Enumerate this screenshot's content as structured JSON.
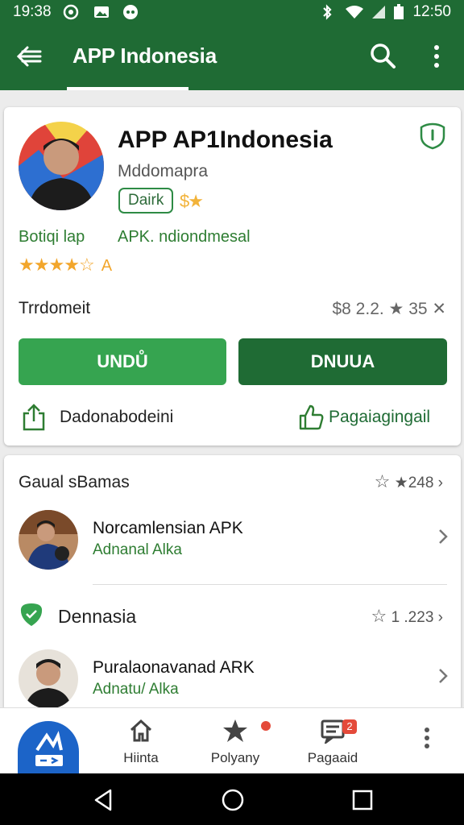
{
  "status_bar": {
    "time_left": "19:38",
    "time_right": "12:50"
  },
  "app_bar": {
    "title": "APP Indonesia"
  },
  "app_card": {
    "name": "APP AP1Indonesia",
    "developer": "Mddomapra",
    "badge": "Dairk",
    "category": "Botiqi lap",
    "apk_label": "APK. ndiondmesal",
    "rating_suffix": "A",
    "downloads_label": "Trrdomeit",
    "downloads_value": "$8 2.2. ★ 35 ✕",
    "primary_button": "UNDŮ",
    "secondary_button": "DNUUA",
    "share_label": "Dadonabodeini",
    "page_label": "Pagaiagingail",
    "rating_stars": 3.5
  },
  "sections": [
    {
      "title": "Gaual sBamas",
      "count": "★248",
      "items": [
        {
          "name": "Norcamlensian APK",
          "sub": "Adnanal Alka"
        }
      ]
    },
    {
      "title": "Dennasia",
      "count": "1 .223",
      "items": [
        {
          "name": "Puralaonavanad ARK",
          "sub": "Adnatu/ Alka"
        }
      ]
    }
  ],
  "bottom_nav": [
    {
      "label": "Hiinta"
    },
    {
      "label": "Polyany"
    },
    {
      "label": "Pagaaid",
      "badge": "2"
    }
  ],
  "colors": {
    "primary": "#1f6b34",
    "accent": "#36a450",
    "star": "#f2a62c"
  }
}
